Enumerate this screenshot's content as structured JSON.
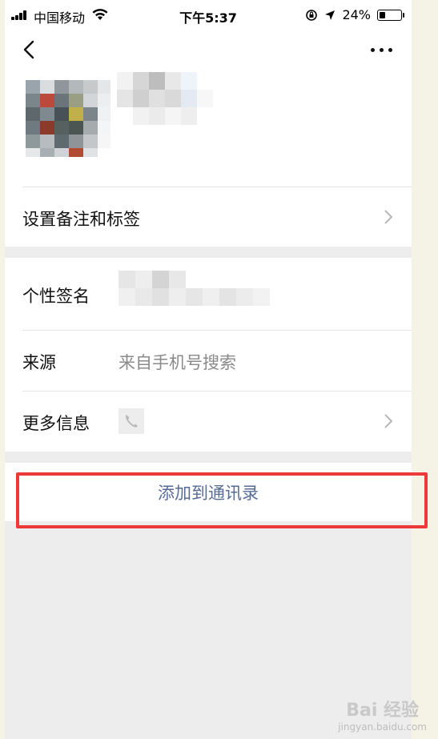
{
  "status_bar": {
    "carrier": "中国移动",
    "time": "下午5:37",
    "battery": "24%"
  },
  "rows": {
    "remark_label": "设置备注和标签",
    "signature_label": "个性签名",
    "source_label": "来源",
    "source_value": "来自手机号搜索",
    "more_info_label": "更多信息"
  },
  "actions": {
    "add_contact": "添加到通讯录"
  },
  "watermark": {
    "main": "Bai 经验",
    "sub": "jingyan.baidu.com"
  },
  "colors": {
    "link": "#576b95",
    "highlight": "#ec3a3a",
    "background": "#ededed"
  },
  "icons": [
    "back-arrow",
    "more-dots",
    "chevron-right",
    "phone",
    "wifi",
    "location-arrow",
    "orientation-lock"
  ]
}
